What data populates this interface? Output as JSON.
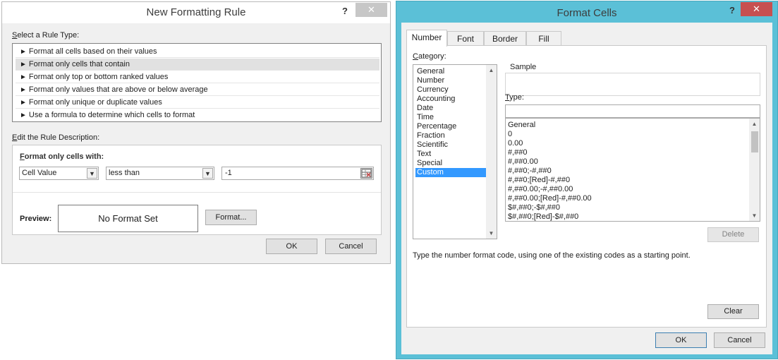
{
  "rule_dialog": {
    "title": "New Formatting Rule",
    "help": "?",
    "close": "✕",
    "rule_type_label_prefix": "S",
    "rule_type_label_rest": "elect a Rule Type:",
    "rule_types": [
      "Format all cells based on their values",
      "Format only cells that contain",
      "Format only top or bottom ranked values",
      "Format only values that are above or below average",
      "Format only unique or duplicate values",
      "Use a formula to determine which cells to format"
    ],
    "selected_rule_index": 1,
    "edit_label_prefix": "E",
    "edit_label_rest": "dit the Rule Description:",
    "format_only_label_prefix": "F",
    "format_only_label_rest": "ormat only cells with:",
    "condition_type": "Cell Value",
    "operator": "less than",
    "value": "-1",
    "preview_label": "Preview:",
    "preview_text": "No Format Set",
    "format_button": "Format...",
    "format_button_underline": "F",
    "ok": "OK",
    "cancel": "Cancel"
  },
  "cells_dialog": {
    "title": "Format Cells",
    "help": "?",
    "close": "✕",
    "tabs": [
      "Number",
      "Font",
      "Border",
      "Fill"
    ],
    "active_tab": "Number",
    "category_label_prefix": "C",
    "category_label_rest": "ategory:",
    "categories": [
      "General",
      "Number",
      "Currency",
      "Accounting",
      "Date",
      "Time",
      "Percentage",
      "Fraction",
      "Scientific",
      "Text",
      "Special",
      "Custom"
    ],
    "selected_category": "Custom",
    "sample_label": "Sample",
    "type_label_prefix": "T",
    "type_label_rest": "ype:",
    "type_value": "",
    "formats": [
      "General",
      "0",
      "0.00",
      "#,##0",
      "#,##0.00",
      "#,##0;-#,##0",
      "#,##0;[Red]-#,##0",
      "#,##0.00;-#,##0.00",
      "#,##0.00;[Red]-#,##0.00",
      "$#,##0;-$#,##0",
      "$#,##0;[Red]-$#,##0"
    ],
    "delete_button": "Delete",
    "hint": "Type the number format code, using one of the existing codes as a starting point.",
    "clear_button": "Clear",
    "ok": "OK",
    "cancel": "Cancel"
  },
  "colors": {
    "accent_border": "#5bc0d7",
    "selection": "#3399ff",
    "close_active": "#c75050"
  }
}
